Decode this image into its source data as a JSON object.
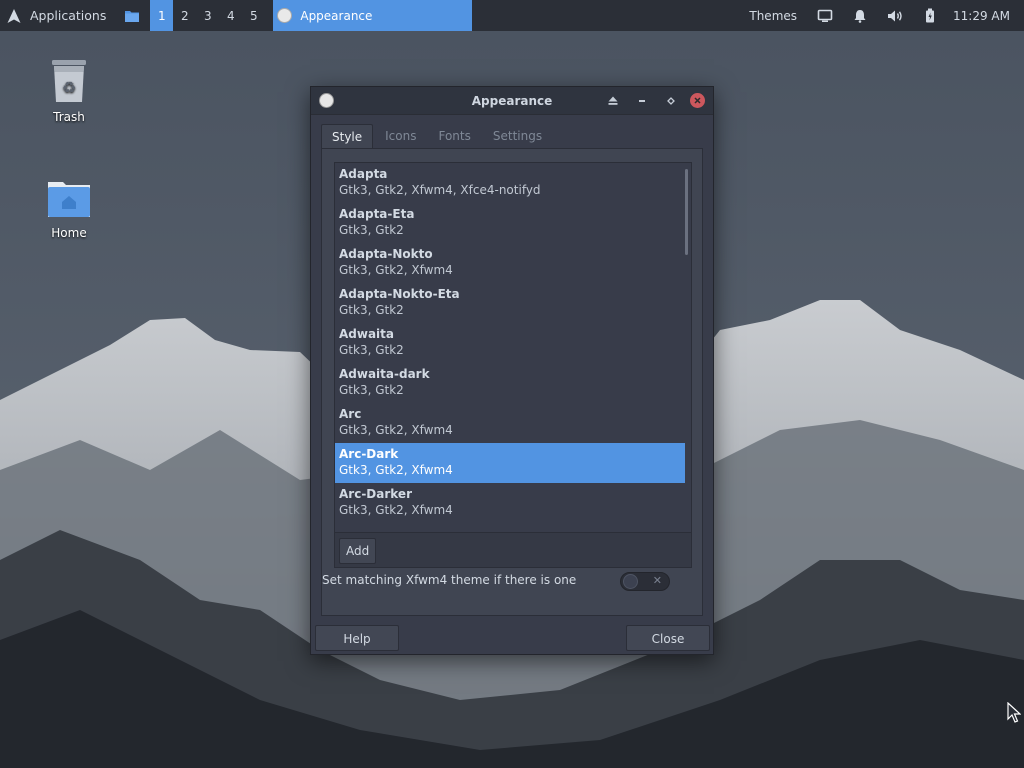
{
  "panel": {
    "applications_label": "Applications",
    "workspaces": [
      "1",
      "2",
      "3",
      "4",
      "5"
    ],
    "active_workspace": "1",
    "task_title": "Appearance",
    "themes_label": "Themes",
    "clock": "11:29 AM",
    "icons": {
      "logo": "arch-logo-icon",
      "folder": "folder-icon",
      "display": "display-icon",
      "notifications": "bell-icon",
      "volume": "volume-icon",
      "battery": "battery-icon"
    }
  },
  "desktop": {
    "icons": [
      {
        "label": "Trash",
        "icon": "trash-icon"
      },
      {
        "label": "Home",
        "icon": "home-folder-icon"
      }
    ]
  },
  "window": {
    "title": "Appearance",
    "tabs": [
      {
        "label": "Style",
        "active": true
      },
      {
        "label": "Icons",
        "active": false
      },
      {
        "label": "Fonts",
        "active": false
      },
      {
        "label": "Settings",
        "active": false
      }
    ],
    "themes": [
      {
        "name": "Adapta",
        "desc": "Gtk3, Gtk2, Xfwm4, Xfce4-notifyd",
        "selected": false
      },
      {
        "name": "Adapta-Eta",
        "desc": "Gtk3, Gtk2",
        "selected": false
      },
      {
        "name": "Adapta-Nokto",
        "desc": "Gtk3, Gtk2, Xfwm4",
        "selected": false
      },
      {
        "name": "Adapta-Nokto-Eta",
        "desc": "Gtk3, Gtk2",
        "selected": false
      },
      {
        "name": "Adwaita",
        "desc": "Gtk3, Gtk2",
        "selected": false
      },
      {
        "name": "Adwaita-dark",
        "desc": "Gtk3, Gtk2",
        "selected": false
      },
      {
        "name": "Arc",
        "desc": "Gtk3, Gtk2, Xfwm4",
        "selected": false
      },
      {
        "name": "Arc-Dark",
        "desc": "Gtk3, Gtk2, Xfwm4",
        "selected": true
      },
      {
        "name": "Arc-Darker",
        "desc": "Gtk3, Gtk2, Xfwm4",
        "selected": false
      }
    ],
    "add_label": "Add",
    "match_label": "Set matching Xfwm4 theme if there is one",
    "match_enabled": false,
    "help_label": "Help",
    "close_label": "Close"
  },
  "colors": {
    "accent": "#5294e2",
    "panel_bg": "#2b2f37",
    "window_bg": "#383c4a",
    "close_button": "#cc575d"
  }
}
